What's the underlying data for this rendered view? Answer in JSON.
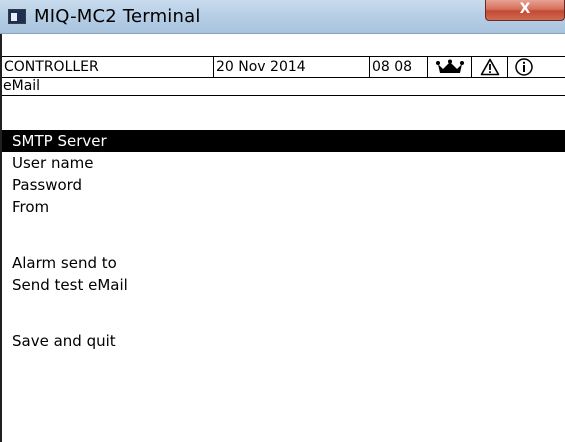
{
  "window": {
    "title": "MIQ-MC2 Terminal",
    "close_label": "X"
  },
  "status_bar": {
    "controller": "CONTROLLER",
    "date": "20 Nov  2014",
    "time": "08 08",
    "icons": [
      "crown-icon",
      "warning-icon",
      "info-icon"
    ]
  },
  "screen": {
    "title": "eMail"
  },
  "menu": {
    "selected_index": 0,
    "items": [
      "SMTP Server",
      "User name",
      "Password",
      "From",
      "Alarm send to",
      "Send test eMail",
      "Save and quit"
    ]
  },
  "colors": {
    "selection_background": "#000000",
    "selection_text": "#ffffff",
    "close_button": "#c24a33"
  }
}
